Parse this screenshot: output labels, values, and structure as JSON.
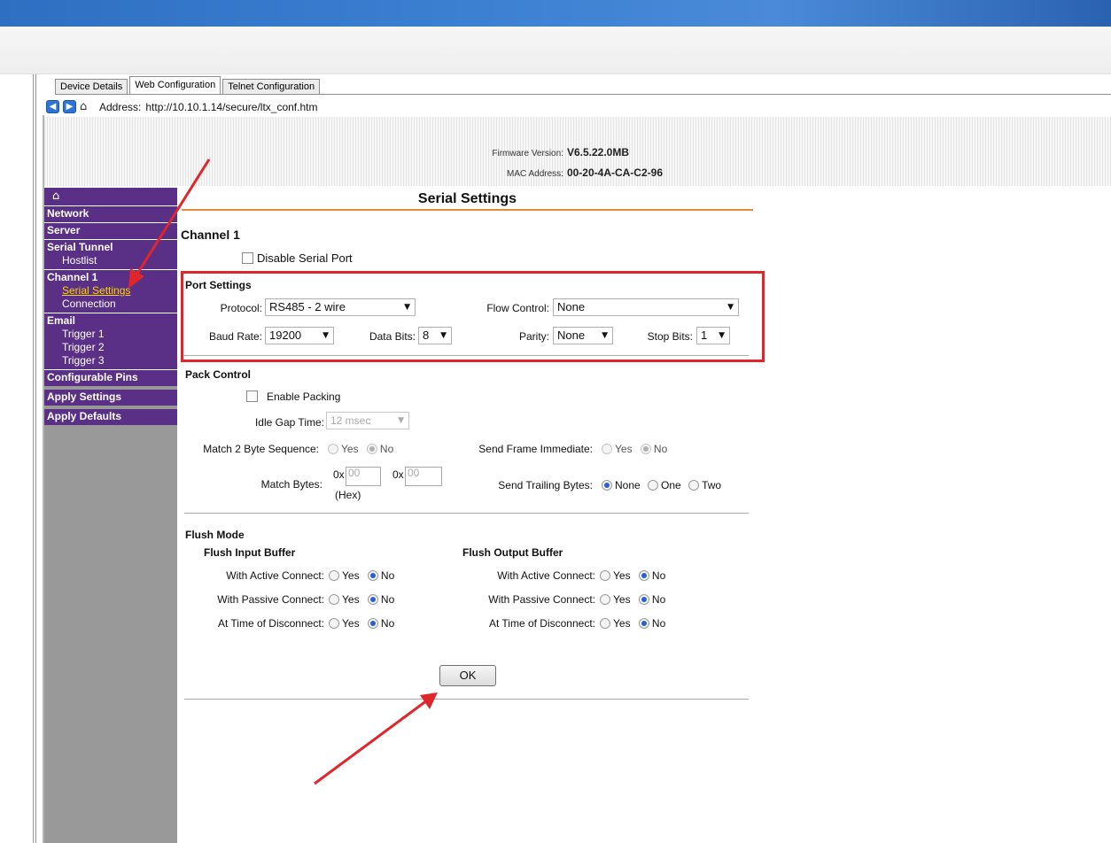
{
  "tabs": [
    {
      "label": "Device Details"
    },
    {
      "label": "Web Configuration"
    },
    {
      "label": "Telnet Configuration"
    }
  ],
  "address_bar": {
    "label": "Address:",
    "url": "http://10.10.1.14/secure/ltx_conf.htm"
  },
  "header": {
    "firmware_label": "Firmware Version:",
    "firmware_value": "V6.5.22.0MB",
    "mac_label": "MAC Address:",
    "mac_value": "00-20-4A-CA-C2-96"
  },
  "sidebar": {
    "home_glyph": "⌂",
    "network": "Network",
    "server": "Server",
    "serial_tunnel": "Serial Tunnel",
    "hostlist": "Hostlist",
    "channel1": "Channel 1",
    "serial_settings": "Serial Settings",
    "connection": "Connection",
    "email": "Email",
    "trigger1": "Trigger 1",
    "trigger2": "Trigger 2",
    "trigger3": "Trigger 3",
    "configurable_pins": "Configurable Pins",
    "apply_settings": "Apply Settings",
    "apply_defaults": "Apply Defaults"
  },
  "main": {
    "title": "Serial Settings",
    "channel_title": "Channel 1",
    "disable_serial_port": "Disable Serial Port"
  },
  "port_settings": {
    "title": "Port Settings",
    "protocol_label": "Protocol:",
    "protocol_value": "RS485 - 2 wire",
    "flow_control_label": "Flow Control:",
    "flow_control_value": "None",
    "baud_rate_label": "Baud Rate:",
    "baud_rate_value": "19200",
    "data_bits_label": "Data Bits:",
    "data_bits_value": "8",
    "parity_label": "Parity:",
    "parity_value": "None",
    "stop_bits_label": "Stop Bits:",
    "stop_bits_value": "1"
  },
  "pack_control": {
    "title": "Pack Control",
    "enable_packing": "Enable Packing",
    "idle_gap_label": "Idle Gap Time:",
    "idle_gap_value": "12 msec",
    "match_seq_label": "Match 2 Byte Sequence:",
    "send_frame_label": "Send Frame Immediate:",
    "match_bytes_label": "Match Bytes:",
    "hex_prefix": "0x",
    "match_byte1": "00",
    "match_byte2": "00",
    "hex_note": "(Hex)",
    "send_trailing_label": "Send Trailing Bytes:",
    "opt_none": "None",
    "opt_one": "One",
    "opt_two": "Two"
  },
  "flush_mode": {
    "title": "Flush Mode",
    "input_title": "Flush Input Buffer",
    "output_title": "Flush Output Buffer",
    "active_label": "With Active Connect:",
    "passive_label": "With Passive Connect:",
    "disconnect_label": "At Time of Disconnect:"
  },
  "common": {
    "yes": "Yes",
    "no": "No",
    "dropdown_arrow": "▼"
  },
  "ok_button": "OK",
  "colors": {
    "sidebar_purple": "#5a2f86",
    "sidebar_current": "#ffd400",
    "title_rule": "#e58a3a",
    "annotation_red": "#e0262b",
    "radio_selected": "#2b5fd8"
  }
}
